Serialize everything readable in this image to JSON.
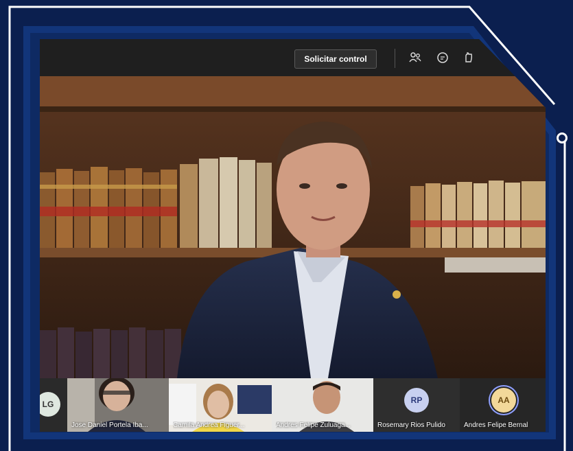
{
  "toolbar": {
    "control_button": "Solicitar control",
    "icons": [
      "people-icon",
      "chat-icon",
      "reactions-icon"
    ]
  },
  "participants": [
    {
      "initials": "LG",
      "name": "",
      "has_video": false
    },
    {
      "initials": "",
      "name": "Jose Daniel Portela Iba...",
      "has_video": true
    },
    {
      "initials": "",
      "name": "Camila Andrea Figuer...",
      "has_video": true
    },
    {
      "initials": "",
      "name": "Andres Felipe Zuluaga...",
      "has_video": true
    },
    {
      "initials": "RP",
      "name": "Rosemary Rios Pulido",
      "has_video": false
    },
    {
      "initials": "AA",
      "name": "Andres Felipe Bernal",
      "has_video": false
    }
  ],
  "colors": {
    "frame_bg": "#0b1f4f",
    "frame_line": "#ffffff",
    "inner_border": "#1a3a7a",
    "avatar_rp": "#c8d0f0",
    "avatar_aa": "#f2d89a"
  }
}
